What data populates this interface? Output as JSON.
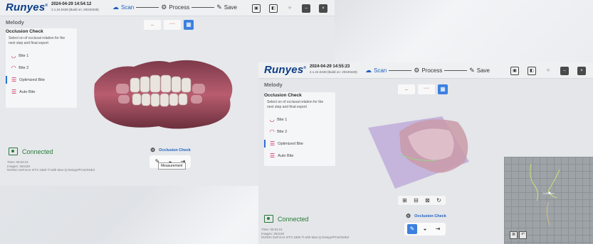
{
  "brand": {
    "logo": "Runyes",
    "trademark": "®"
  },
  "steps": [
    {
      "label": "Scan",
      "icon": "scan-icon"
    },
    {
      "label": "Process",
      "icon": "process-icon"
    },
    {
      "label": "Save",
      "icon": "save-icon"
    }
  ],
  "winA": {
    "datetime": "2024-04-29 14:54:12",
    "build": "2.1.24.0428 (Build on: 20240428)",
    "patient": "Melody",
    "panel_title": "Occlusion Check",
    "panel_desc": "Select on of occlusal relation for the next step and final export",
    "options": [
      "Bite 1",
      "Bite 2",
      "Optimized Bite",
      "Auto Bite"
    ],
    "connected": "Connected",
    "info": [
      "Time: 00:04:21",
      "Images: 254119",
      "NVIDIA GeForce GTX 1660 Ti with Max-Q Design/PCIe/SSE2"
    ],
    "occlusion_check": "Occlusion Check",
    "tooltip": "Measurement"
  },
  "winB": {
    "datetime": "2024-04-29 14:55:23",
    "build": "2.1.24.0428 (Build on: 20240428)",
    "patient": "Melody",
    "panel_title": "Occlusion Check",
    "panel_desc": "Select on of occlusal relation for the next step and final export",
    "options": [
      "Bite 1",
      "Bite 2",
      "Optimized Bite",
      "Auto Bite"
    ],
    "connected": "Connected",
    "info": [
      "Time: 00:04:21",
      "Images: 254119",
      "NVIDIA GeForce GTX 1660 Ti with Max-Q Design/PCIe/SSE2"
    ],
    "occlusion_check": "Occlusion Check",
    "minimap_value": "2.83 mm"
  },
  "colors": {
    "accent": "#3b80e0",
    "brand": "#0d3e86",
    "connected": "#2a7a3a",
    "sidebar_accent": "#2a6fd6"
  }
}
